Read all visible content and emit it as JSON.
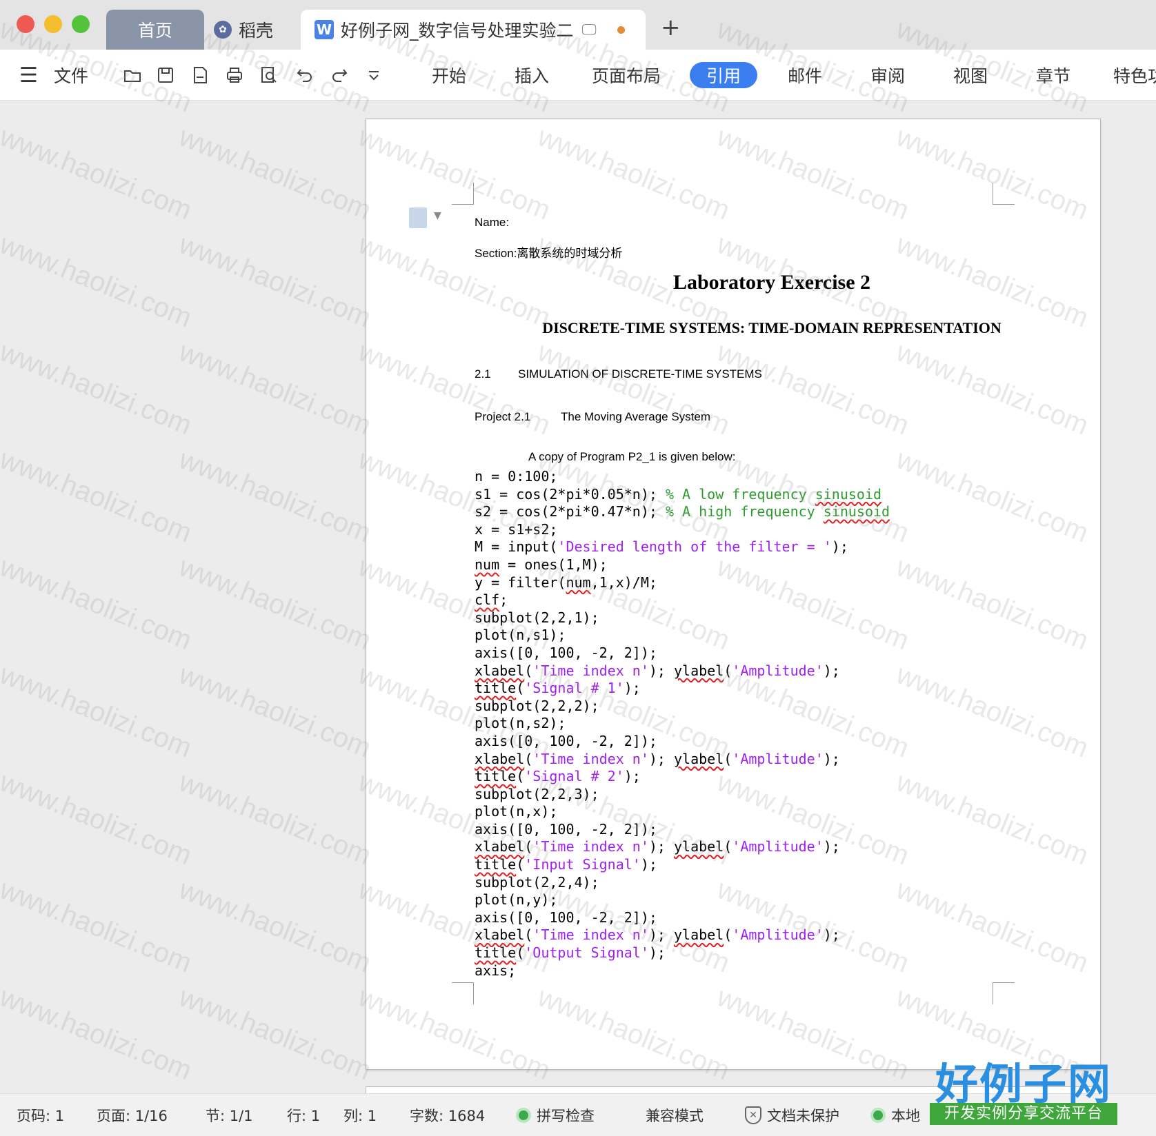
{
  "window": {
    "tabs": [
      {
        "label": "首页"
      },
      {
        "label": "稻壳"
      },
      {
        "label": "好例子网_数字信号处理实验二"
      }
    ],
    "add_tab": "+"
  },
  "toolbar": {
    "file_label": "文件",
    "ribbon_tabs": [
      "开始",
      "插入",
      "页面布局",
      "引用",
      "邮件",
      "审阅",
      "视图",
      "章节",
      "特色功能"
    ],
    "active_tab": "引用"
  },
  "document": {
    "name_label": "Name:",
    "section_label": "Section:离散系统的时域分析",
    "title": "Laboratory Exercise 2",
    "subtitle": "DISCRETE-TIME SYSTEMS: TIME-DOMAIN REPRESENTATION",
    "section_number": "2.1",
    "section_title": "SIMULATION OF DISCRETE-TIME SYSTEMS",
    "project_number": "Project 2.1",
    "project_title": "The Moving Average System",
    "copy_line": "A copy of Program P2_1 is given below:",
    "code_lines": [
      "n = 0:100;",
      "s1 = cos(2*pi*0.05*n); % A low frequency sinusoid",
      "s2 = cos(2*pi*0.47*n); % A high frequency sinusoid",
      "x = s1+s2;",
      "M = input('Desired length of the filter = ');",
      "num = ones(1,M);",
      "y = filter(num,1,x)/M;",
      "clf;",
      "subplot(2,2,1);",
      "plot(n,s1);",
      "axis([0, 100, -2, 2]);",
      "xlabel('Time index n'); ylabel('Amplitude');",
      "title('Signal # 1');",
      "subplot(2,2,2);",
      "plot(n,s2);",
      "axis([0, 100, -2, 2]);",
      "xlabel('Time index n'); ylabel('Amplitude');",
      "title('Signal # 2');",
      "subplot(2,2,3);",
      "plot(n,x);",
      "axis([0, 100, -2, 2]);",
      "xlabel('Time index n'); ylabel('Amplitude');",
      "title('Input Signal');",
      "subplot(2,2,4);",
      "plot(n,y);",
      "axis([0, 100, -2, 2]);",
      "xlabel('Time index n'); ylabel('Amplitude');",
      "title('Output Signal');",
      "axis;"
    ]
  },
  "statusbar": {
    "page_code": "页码: 1",
    "page": "页面: 1/16",
    "section": "节: 1/1",
    "row": "行: 1",
    "col": "列: 1",
    "word_count": "字数: 1684",
    "spell_check": "拼写检查",
    "compat_mode": "兼容模式",
    "doc_protect": "文档未保护",
    "local": "本地"
  },
  "watermark": "www.haolizi.com",
  "logo": {
    "title": "好例子网",
    "tagline": "开发实例分享交流平台"
  },
  "colors": {
    "accent": "#3b7ef0",
    "code_comment": "#2e9b2e",
    "code_string": "#a020f0",
    "spell_underline": "#e02020",
    "logo_blue": "#2a8fe0",
    "logo_green": "#3fa63c"
  }
}
